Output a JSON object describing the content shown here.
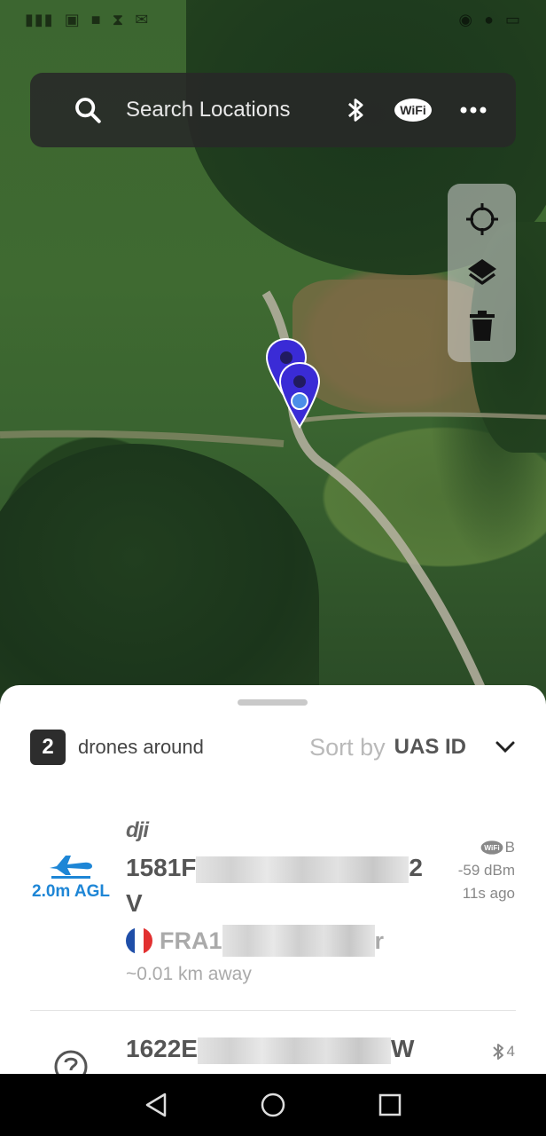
{
  "search": {
    "placeholder": "Search Locations"
  },
  "summary": {
    "count": "2",
    "count_label": "drones around"
  },
  "sort": {
    "prefix": "Sort by",
    "value": "UAS ID"
  },
  "drones": [
    {
      "brand": "dji",
      "uas_id_start": "1581F",
      "uas_id_end": "2",
      "uas_id_line2": "V",
      "agl": "2.0m AGL",
      "status_icon": "airplane-icon",
      "operator_start": "FRA1",
      "operator_end": "r",
      "operator_country": "France",
      "distance": "~0.01 km away",
      "tech_icon": "wifi-icon",
      "tech_suffix": "B",
      "rssi": "-59 dBm",
      "age": "11s ago"
    },
    {
      "uas_id_start": "1622E",
      "uas_id_end": "W",
      "status_icon": "question-icon",
      "tech_icon": "bluetooth-icon",
      "tech_suffix": "4"
    }
  ],
  "colors": {
    "accent": "#1e86d6",
    "marker": "#3a2bd6",
    "user_location": "#4c8ee8"
  }
}
